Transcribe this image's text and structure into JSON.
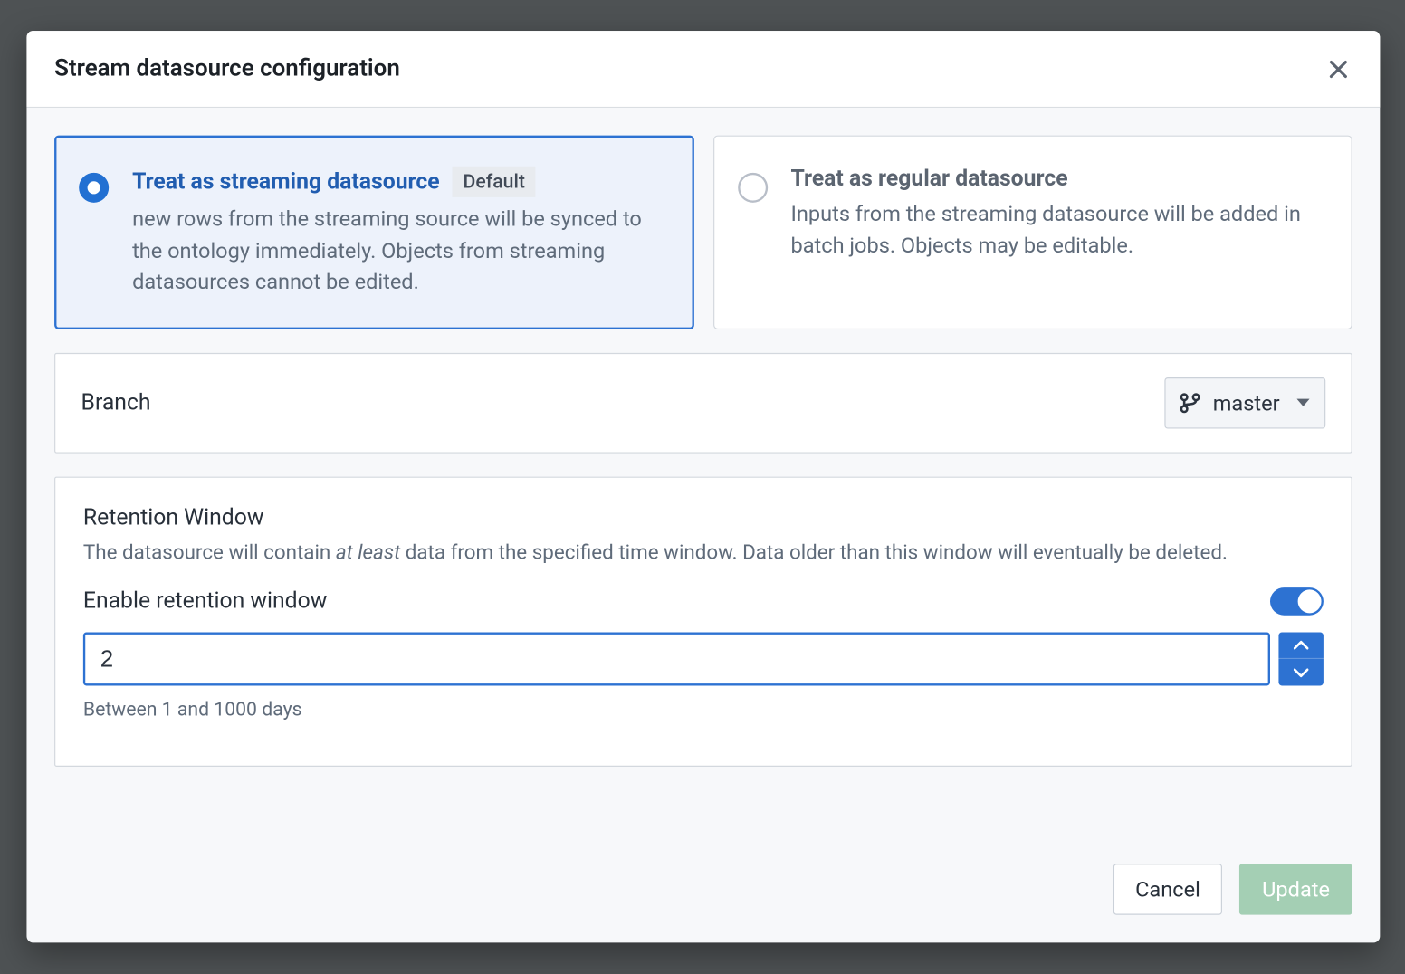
{
  "modal": {
    "title": "Stream datasource configuration"
  },
  "options": {
    "streaming": {
      "title": "Treat as streaming datasource",
      "badge": "Default",
      "desc": "new rows from the streaming source will be synced to the ontology immediately. Objects from streaming datasources cannot be edited.",
      "selected": true
    },
    "regular": {
      "title": "Treat as regular datasource",
      "desc": "Inputs from the streaming datasource will be added in batch jobs. Objects may be editable.",
      "selected": false
    }
  },
  "branch": {
    "label": "Branch",
    "selected": "master"
  },
  "retention": {
    "title": "Retention Window",
    "subtitle_before": "The datasource will contain ",
    "subtitle_em": "at least",
    "subtitle_after": " data from the specified time window. Data older than this window will eventually be deleted.",
    "enable_label": "Enable retention window",
    "enabled": true,
    "value": "2",
    "helper": "Between 1 and 1000 days"
  },
  "footer": {
    "cancel": "Cancel",
    "update": "Update"
  }
}
